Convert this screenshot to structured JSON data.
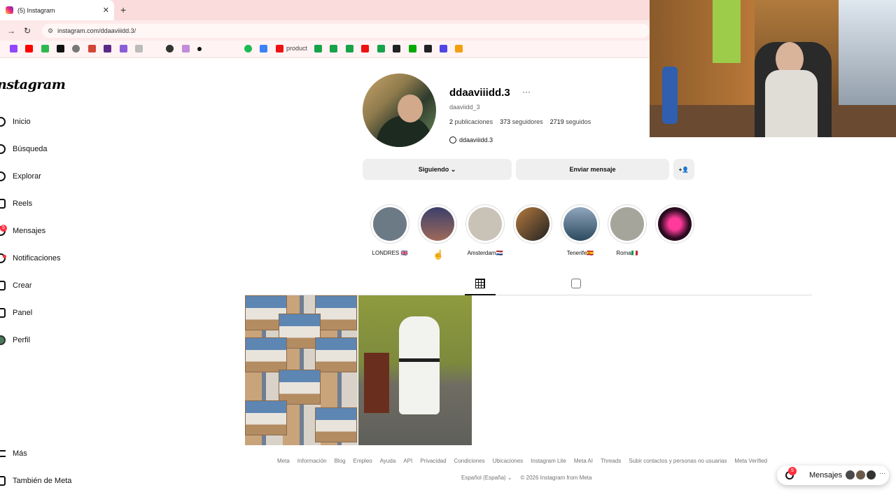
{
  "browser": {
    "tab_title": "(5) Instagram",
    "tab_close": "✕",
    "new_tab": "+",
    "back": "→",
    "reload": "↻",
    "url": "instagram.com/ddaaviiidd.3/",
    "bookmark_text": "product"
  },
  "sidebar": {
    "logo": "nstagram",
    "items": [
      {
        "label": "Inicio",
        "icon": "home-icon"
      },
      {
        "label": "Búsqueda",
        "icon": "search-icon"
      },
      {
        "label": "Explorar",
        "icon": "compass-icon"
      },
      {
        "label": "Reels",
        "icon": "reels-icon"
      },
      {
        "label": "Mensajes",
        "icon": "messenger-icon",
        "badge": "5"
      },
      {
        "label": "Notificaciones",
        "icon": "heart-icon"
      },
      {
        "label": "Crear",
        "icon": "plus-icon"
      },
      {
        "label": "Panel",
        "icon": "chart-icon"
      },
      {
        "label": "Perfil",
        "icon": "avatar-icon"
      },
      {
        "label": "Más",
        "icon": "menu-icon"
      },
      {
        "label": "También de Meta",
        "icon": "meta-icon"
      }
    ]
  },
  "profile": {
    "username": "ddaaviiidd.3",
    "more": "···",
    "handle": "daaviidd_3",
    "posts_count": "2",
    "posts_label": "publicaciones",
    "followers_count": "373",
    "followers_label": "seguidores",
    "following_count": "2719",
    "following_label": "seguidos",
    "threads_handle": "ddaaviiidd.3",
    "following_button": "Siguiendo ⌄",
    "message_button": "Enviar mensaje",
    "suggest_icon": "+👤"
  },
  "highlights": [
    {
      "label": "LONDRES 🇬🇧",
      "color": "#6c7a86"
    },
    {
      "label": "",
      "color": "#5a4a6a"
    },
    {
      "label": "Amsterdam🇳🇱",
      "color": "#c9c2b7"
    },
    {
      "label": "",
      "color": "#9b6b3f"
    },
    {
      "label": "Tenerife🇪🇸",
      "color": "#4b6277"
    },
    {
      "label": "Roma🇮🇹",
      "color": "#a6a59c"
    },
    {
      "label": "",
      "color": "#2b0b1f"
    }
  ],
  "footer": {
    "links": [
      "Meta",
      "Información",
      "Blog",
      "Empleo",
      "Ayuda",
      "API",
      "Privacidad",
      "Condiciones",
      "Ubicaciones",
      "Instagram Lite",
      "Meta AI",
      "Threads",
      "Subir contactos y personas no usuarias",
      "Meta Verified"
    ],
    "language": "Español (España) ⌄",
    "copyright": "© 2026 Instagram from Meta"
  },
  "messages_pill": {
    "label": "Mensajes",
    "badge": "5",
    "more": "···"
  },
  "colors": {
    "tabbar": "#fbdcdc",
    "badge": "#ff3040",
    "button_bg": "#efefef"
  }
}
